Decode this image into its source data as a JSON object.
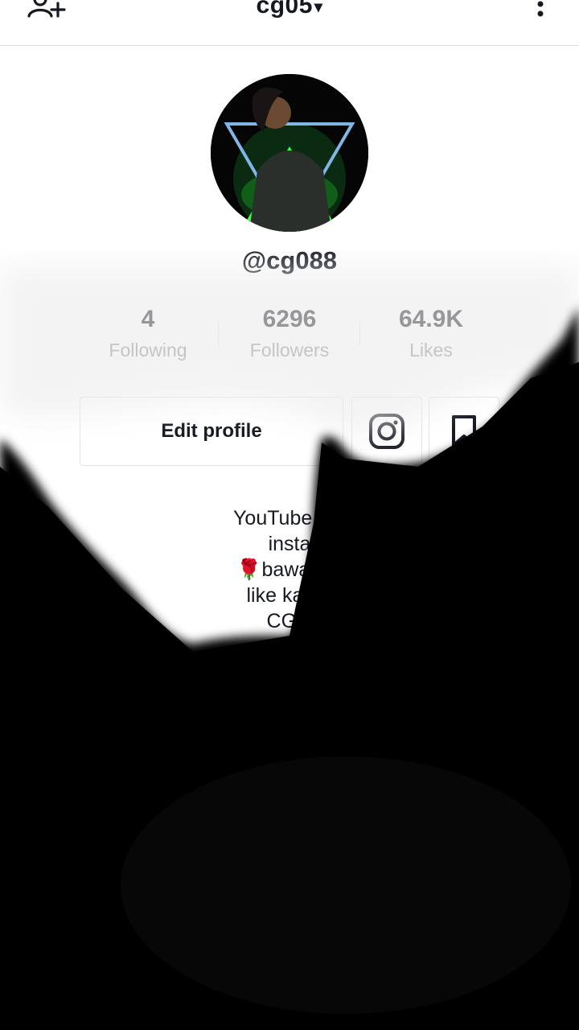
{
  "header": {
    "account_name": "cg05",
    "caret": "▾"
  },
  "profile": {
    "handle": "@cg088"
  },
  "stats": [
    {
      "value": "4",
      "label": "Following"
    },
    {
      "value": "6296",
      "label": "Followers"
    },
    {
      "value": "64.9K",
      "label": "Likes"
    }
  ],
  "actions": {
    "edit_label": "Edit profile",
    "instagram_icon": "instagram-icon",
    "bookmark_icon": "bookmark-icon"
  },
  "bio": {
    "lines": [
      "YouTube vdr",
      "insta",
      "🌹bawal Lo",
      "like karo f",
      "CG ti"
    ]
  },
  "colors": {
    "text": "#161823",
    "secondary": "#8a8b91",
    "border": "#e3e3e4",
    "overlay": "#000000"
  }
}
